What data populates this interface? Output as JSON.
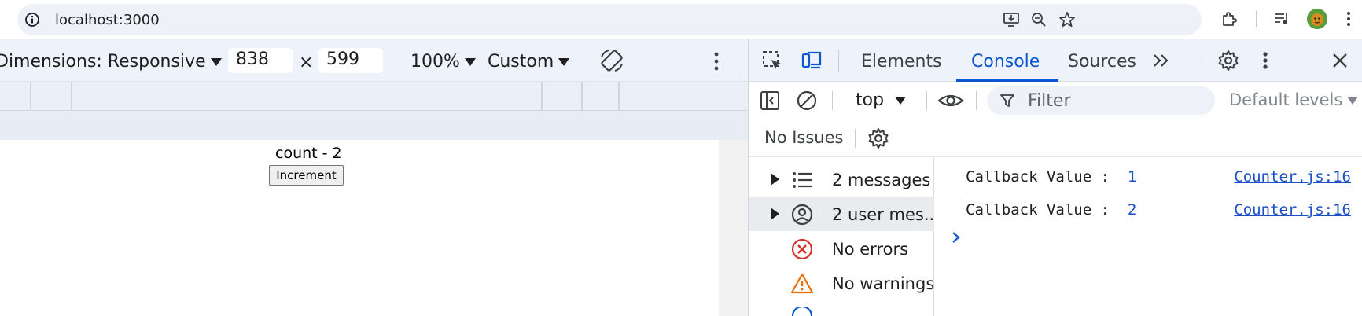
{
  "browser": {
    "url": "localhost:3000"
  },
  "device_toolbar": {
    "dimensions_label": "Dimensions: Responsive",
    "width": "838",
    "times": "×",
    "height": "599",
    "zoom": "100%",
    "throttle": "Custom"
  },
  "page": {
    "count_text": "count - 2",
    "increment_label": "Increment"
  },
  "devtools": {
    "tabs": [
      "Elements",
      "Console",
      "Sources"
    ],
    "active_tab": "Console",
    "console": {
      "context": "top",
      "filter_placeholder": "Filter",
      "levels": "Default levels",
      "issues": "No Issues",
      "sidebar": [
        {
          "label": "2 messages",
          "icon": "list-icon"
        },
        {
          "label": "2 user mes...",
          "icon": "user-icon"
        },
        {
          "label": "No errors",
          "icon": "error-icon"
        },
        {
          "label": "No warnings",
          "icon": "warning-icon"
        }
      ],
      "logs": [
        {
          "text": "Callback Value :  ",
          "value": "1",
          "source": "Counter.js:16"
        },
        {
          "text": "Callback Value :  ",
          "value": "2",
          "source": "Counter.js:16"
        }
      ]
    }
  },
  "colors": {
    "accent": "#0b57d0",
    "error": "#d93025",
    "warning": "#e8710a"
  }
}
